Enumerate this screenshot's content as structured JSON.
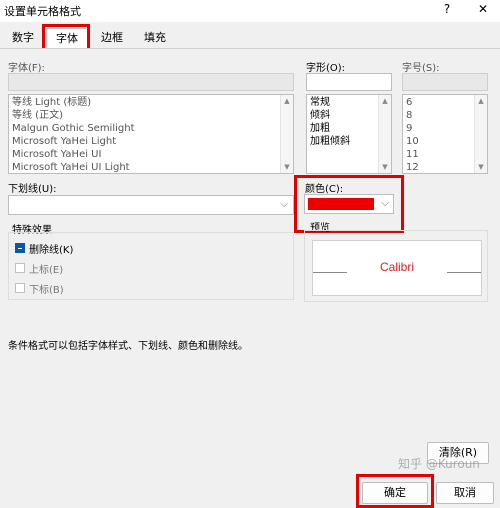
{
  "dialog": {
    "title": "设置单元格格式",
    "help_label": "?",
    "close_label": "✕"
  },
  "tabs": [
    {
      "label": "数字"
    },
    {
      "label": "字体"
    },
    {
      "label": "边框"
    },
    {
      "label": "填充"
    }
  ],
  "font": {
    "label": "字体(F):",
    "items": [
      "等线 Light (标题)",
      "等线 (正文)",
      "Malgun Gothic Semilight",
      "Microsoft YaHei Light",
      "Microsoft YaHei UI",
      "Microsoft YaHei UI Light"
    ]
  },
  "style": {
    "label": "字形(O):",
    "items": [
      "常规",
      "倾斜",
      "加粗",
      "加粗倾斜"
    ]
  },
  "size": {
    "label": "字号(S):",
    "items": [
      "6",
      "8",
      "9",
      "10",
      "11",
      "12"
    ]
  },
  "underline": {
    "label": "下划线(U):"
  },
  "color": {
    "label": "颜色(C):",
    "swatch": "#ee0000"
  },
  "effects": {
    "title": "特殊效果",
    "strikethrough": "删除线(K)",
    "superscript": "上标(E)",
    "subscript": "下标(B)"
  },
  "preview": {
    "label": "预览",
    "sample": "Calibri",
    "sample_color": "#e02020"
  },
  "note": "条件格式可以包括字体样式、下划线、颜色和删除线。",
  "buttons": {
    "clear": "清除(R)",
    "ok": "确定",
    "cancel": "取消"
  },
  "watermark": "知乎 @Kuroun",
  "accent_red": "#e20000"
}
